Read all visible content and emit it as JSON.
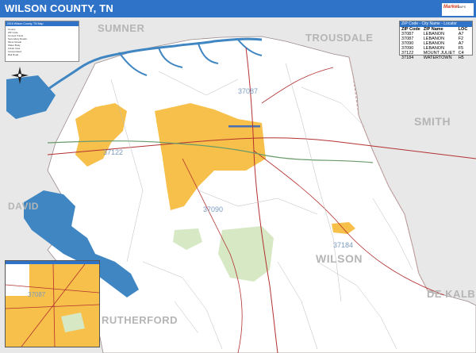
{
  "title": "WILSON COUNTY, TN",
  "legend": {
    "title": "2016 Wilson County, TN Map",
    "rows": [
      "County",
      "ZIP Code",
      "Census Tracts",
      "Secondary Roads",
      "Minor Roads",
      "Water Body",
      "Urban Area",
      "Incorporated",
      "Rail Road"
    ]
  },
  "zip_table": {
    "title": "ZIP Code - City Name - Locator",
    "headers": [
      "ZIP Code",
      "ZIP Name",
      "LOC"
    ],
    "rows": [
      [
        "37087",
        "LEBANON",
        "A7"
      ],
      [
        "37087",
        "LEBANON",
        "F2"
      ],
      [
        "37090",
        "LEBANON",
        "A7"
      ],
      [
        "37090",
        "LEBANON",
        "F5"
      ],
      [
        "37122",
        "MOUNT JULIET",
        "C4"
      ],
      [
        "37184",
        "WATERTOWN",
        "H5"
      ]
    ]
  },
  "county_labels": {
    "sumner": "SUMNER",
    "trousdale": "TROUSDALE",
    "smith": "SMITH",
    "davidson": "DAVID",
    "wilson": "WILSON",
    "dekalb": "DE KALB",
    "rutherford": "RUTHERFORD"
  },
  "zip_labels": {
    "z1": "37087",
    "z2": "37122",
    "z3": "37090",
    "z4": "37184",
    "inset": "37087"
  },
  "logo": {
    "brand": "Market",
    "brand2": "MAPS"
  },
  "colors": {
    "titlebar": "#2f73c9",
    "urban": "#f7c04a",
    "water": "#3f86c2",
    "county_fill": "#ffffff",
    "outside": "#e8e8e8",
    "parks": "#d6e8c4"
  }
}
